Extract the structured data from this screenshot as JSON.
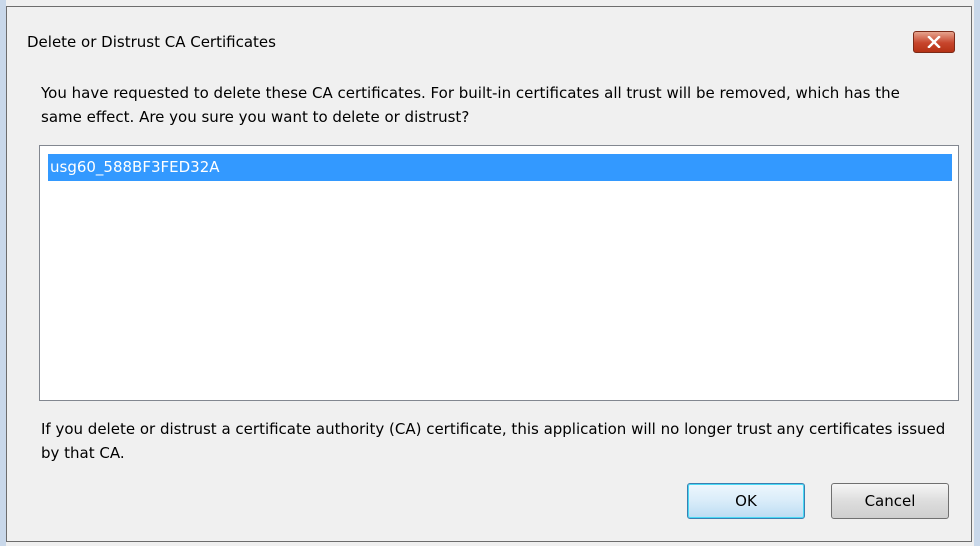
{
  "dialog": {
    "title": "Delete or Distrust CA Certificates",
    "close_icon": "close-icon",
    "message": "You have requested to delete these CA certificates. For built-in certificates all trust will be removed, which has the same effect. Are you sure you want to delete or distrust?",
    "certificates": [
      "usg60_588BF3FED32A"
    ],
    "footnote": "If you delete or distrust a certificate authority (CA) certificate, this application will no longer trust any certificates issued by that CA.",
    "ok_label": "OK",
    "cancel_label": "Cancel"
  },
  "colors": {
    "selection": "#3399ff",
    "close_button": "#c7452c",
    "window_bg": "#f0f0f0"
  }
}
